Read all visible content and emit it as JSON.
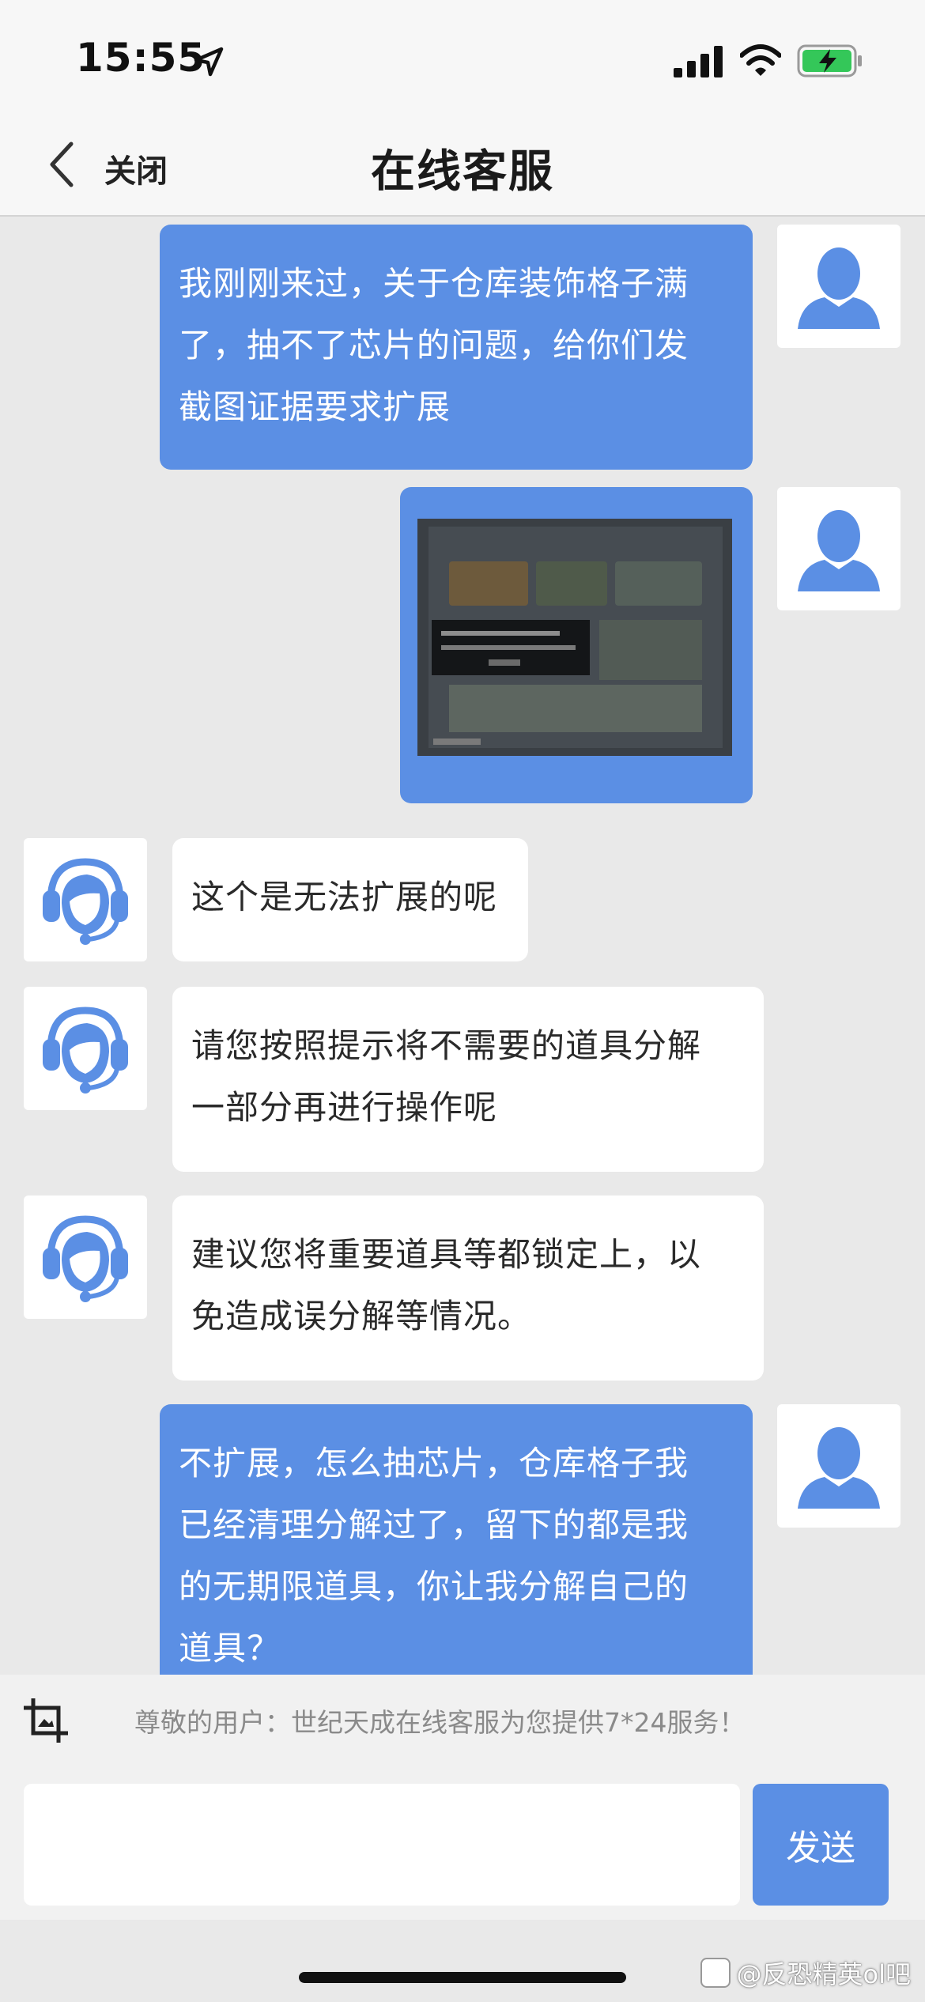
{
  "status_bar": {
    "time": "15:55",
    "icons": [
      "location-arrow-icon",
      "cellular-signal-icon",
      "wifi-icon",
      "battery-charging-icon"
    ],
    "battery_color": "#34c759"
  },
  "nav": {
    "back_label": "关闭",
    "title": "在线客服"
  },
  "colors": {
    "user_bubble": "#5b8fe4",
    "agent_bubble": "#ffffff",
    "avatar_icon": "#5b8fe4",
    "send_button": "#5b8fe4"
  },
  "messages": [
    {
      "sender": "user",
      "type": "text",
      "lines": [
        "我刚刚来过，关于仓库装饰格子满",
        "了，抽不了芯片的问题，给你们发",
        "截图证据要求扩展"
      ]
    },
    {
      "sender": "user",
      "type": "image",
      "caption": "screenshot-photo"
    },
    {
      "sender": "agent",
      "type": "text",
      "lines": [
        "这个是无法扩展的呢"
      ]
    },
    {
      "sender": "agent",
      "type": "text",
      "lines": [
        "请您按照提示将不需要的道具分解",
        "一部分再进行操作呢"
      ]
    },
    {
      "sender": "agent",
      "type": "text",
      "lines": [
        "建议您将重要道具等都锁定上，以",
        "免造成误分解等情况。"
      ]
    },
    {
      "sender": "user",
      "type": "text",
      "lines": [
        "不扩展，怎么抽芯片，仓库格子我",
        "已经清理分解过了，留下的都是我",
        "的无期限道具，你让我分解自己的",
        "道具？"
      ]
    }
  ],
  "footer": {
    "notice": "尊敬的用户：世纪天成在线客服为您提供7*24服务！",
    "input_value": "",
    "input_placeholder": "",
    "send_label": "发送"
  },
  "watermark": "@反恐精英ol吧"
}
